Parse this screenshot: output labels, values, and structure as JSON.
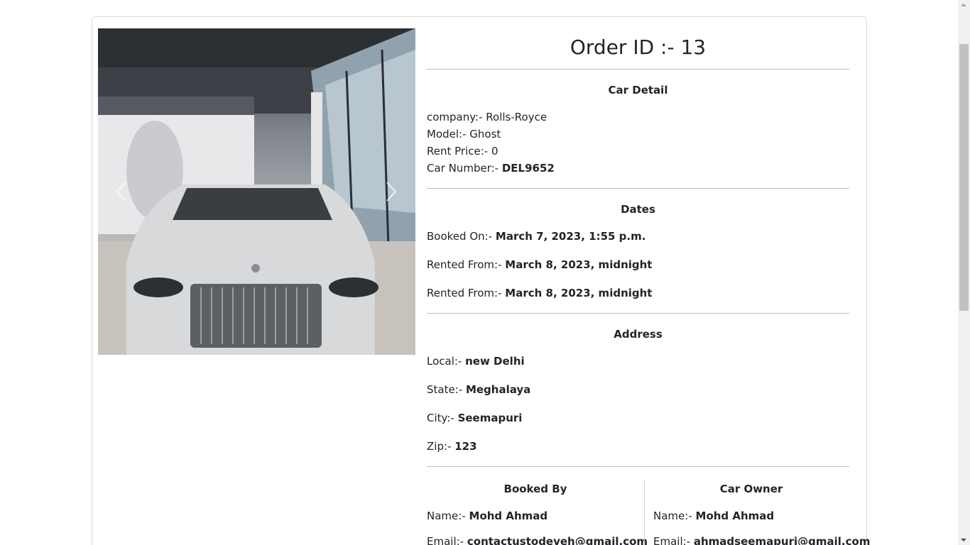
{
  "order": {
    "title": "Order ID :- 13"
  },
  "car_detail": {
    "heading": "Car Detail",
    "company_label": "company:-",
    "company_value": "Rolls-Royce",
    "model_label": "Model:-",
    "model_value": "Ghost",
    "rent_label": "Rent Price:-",
    "rent_value": "0",
    "number_label": "Car Number:-",
    "number_value": "DEL9652"
  },
  "dates": {
    "heading": "Dates",
    "booked_label": "Booked On:-",
    "booked_value": "March 7, 2023, 1:55 p.m.",
    "from_label": "Rented From:-",
    "from_value": "March 8, 2023, midnight",
    "to_label": "Rented From:-",
    "to_value": "March 8, 2023, midnight"
  },
  "address": {
    "heading": "Address",
    "local_label": "Local:-",
    "local_value": "new Delhi",
    "state_label": "State:-",
    "state_value": "Meghalaya",
    "city_label": "City:-",
    "city_value": "Seemapuri",
    "zip_label": "Zip:-",
    "zip_value": "123"
  },
  "booked_by": {
    "heading": "Booked By",
    "name_label": "Name:-",
    "name_value": "Mohd Ahmad",
    "email_label": "Email:-",
    "email_value": "contactustodeveh@gmail.com"
  },
  "car_owner": {
    "heading": "Car Owner",
    "name_label": "Name:-",
    "name_value": "Mohd Ahmad",
    "email_label": "Email:-",
    "email_value": "ahmadseemapuri@gmail.com"
  },
  "icons": {
    "prev": "chevron-left-icon",
    "next": "chevron-right-icon"
  },
  "colors": {
    "text": "#212529",
    "divider": "#bdbdbd",
    "card_border": "#d9d9d9"
  }
}
